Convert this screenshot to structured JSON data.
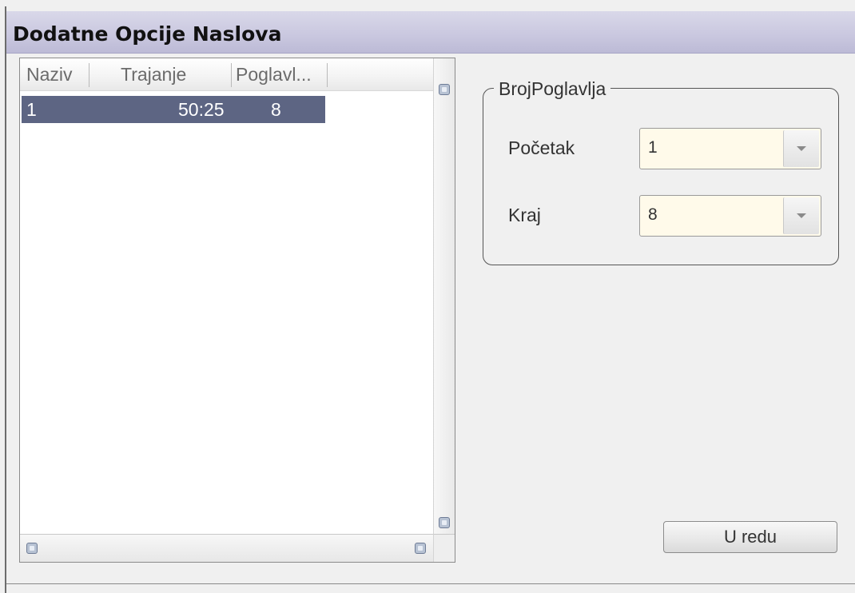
{
  "window": {
    "title": "Dodatne Opcije Naslova"
  },
  "list": {
    "columns": [
      "Naziv",
      "Trajanje",
      "Poglavl..."
    ],
    "rows": [
      {
        "naziv": "1",
        "trajanje": "50:25",
        "poglavlja": "8"
      }
    ]
  },
  "chapters": {
    "legend": "BrojPoglavlja",
    "start": {
      "label": "Početak",
      "value": "1"
    },
    "end": {
      "label": "Kraj",
      "value": "8"
    }
  },
  "actions": {
    "ok_label": "U redu"
  },
  "colors": {
    "selection": "#5d6583",
    "combo_bg": "#fffaea",
    "titlebar": "#c9c7df"
  }
}
